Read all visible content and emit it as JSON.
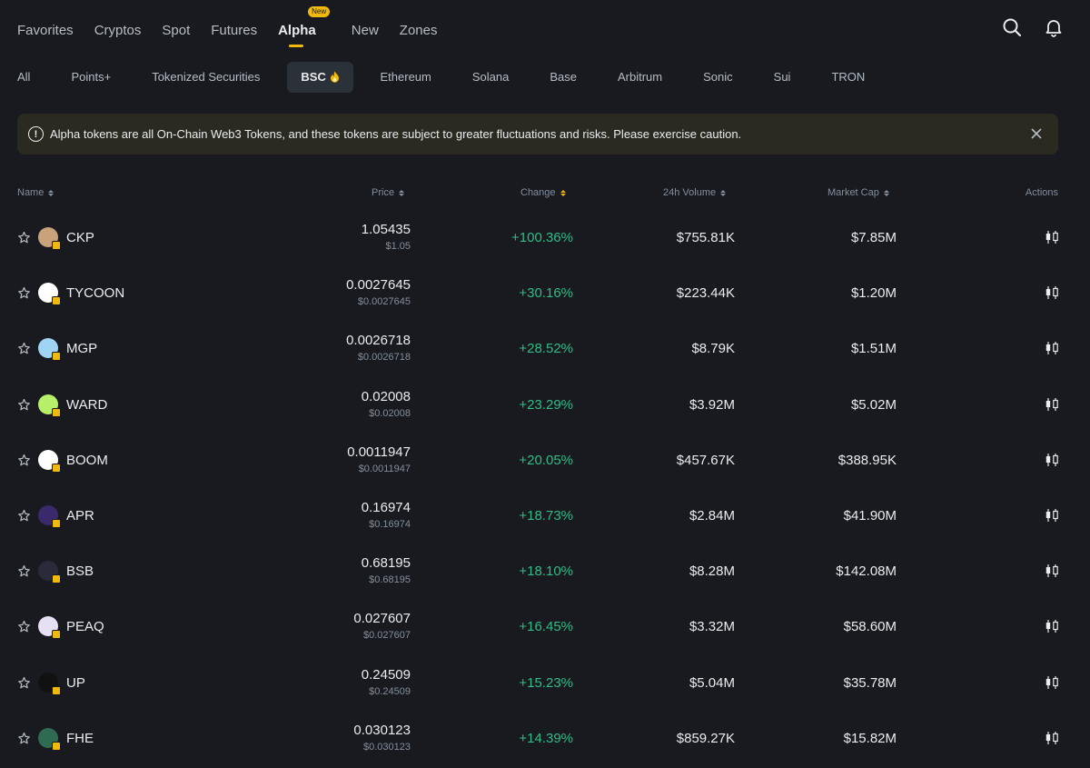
{
  "nav": {
    "tabs": [
      {
        "label": "Favorites"
      },
      {
        "label": "Cryptos"
      },
      {
        "label": "Spot"
      },
      {
        "label": "Futures"
      },
      {
        "label": "Alpha",
        "badge": "New",
        "active": true
      },
      {
        "label": "New"
      },
      {
        "label": "Zones"
      }
    ],
    "icons": [
      "search-icon",
      "bell-icon"
    ]
  },
  "chains": [
    {
      "label": "All"
    },
    {
      "label": "Points+"
    },
    {
      "label": "Tokenized Securities"
    },
    {
      "label": "BSC",
      "active": true,
      "icon": "fire-icon"
    },
    {
      "label": "Ethereum"
    },
    {
      "label": "Solana"
    },
    {
      "label": "Base"
    },
    {
      "label": "Arbitrum"
    },
    {
      "label": "Sonic"
    },
    {
      "label": "Sui"
    },
    {
      "label": "TRON"
    }
  ],
  "banner": {
    "message": "Alpha tokens are all On-Chain Web3 Tokens, and these tokens are subject to greater fluctuations and risks. Please exercise caution.",
    "icon": "alert-circle-icon"
  },
  "table": {
    "headers": {
      "name": "Name",
      "price": "Price",
      "change": "Change",
      "volume": "24h Volume",
      "mcap": "Market Cap",
      "actions": "Actions"
    },
    "rows": [
      {
        "symbol": "CKP",
        "price": "1.05435",
        "usd": "$1.05",
        "change": "+100.36%",
        "volume": "$755.81K",
        "mcap": "$7.85M",
        "color": "#c8a27a"
      },
      {
        "symbol": "TYCOON",
        "price": "0.0027645",
        "usd": "$0.0027645",
        "change": "+30.16%",
        "volume": "$223.44K",
        "mcap": "$1.20M",
        "color": "#ffffff"
      },
      {
        "symbol": "MGP",
        "price": "0.0026718",
        "usd": "$0.0026718",
        "change": "+28.52%",
        "volume": "$8.79K",
        "mcap": "$1.51M",
        "color": "#9fd4f5"
      },
      {
        "symbol": "WARD",
        "price": "0.02008",
        "usd": "$0.02008",
        "change": "+23.29%",
        "volume": "$3.92M",
        "mcap": "$5.02M",
        "color": "#b6f06a"
      },
      {
        "symbol": "BOOM",
        "price": "0.0011947",
        "usd": "$0.0011947",
        "change": "+20.05%",
        "volume": "$457.67K",
        "mcap": "$388.95K",
        "color": "#ffffff"
      },
      {
        "symbol": "APR",
        "price": "0.16974",
        "usd": "$0.16974",
        "change": "+18.73%",
        "volume": "$2.84M",
        "mcap": "$41.90M",
        "color": "#3a2a6b"
      },
      {
        "symbol": "BSB",
        "price": "0.68195",
        "usd": "$0.68195",
        "change": "+18.10%",
        "volume": "$8.28M",
        "mcap": "$142.08M",
        "color": "#2a2a3a"
      },
      {
        "symbol": "PEAQ",
        "price": "0.027607",
        "usd": "$0.027607",
        "change": "+16.45%",
        "volume": "$3.32M",
        "mcap": "$58.60M",
        "color": "#e6e0f5"
      },
      {
        "symbol": "UP",
        "price": "0.24509",
        "usd": "$0.24509",
        "change": "+15.23%",
        "volume": "$5.04M",
        "mcap": "$35.78M",
        "color": "#111111"
      },
      {
        "symbol": "FHE",
        "price": "0.030123",
        "usd": "$0.030123",
        "change": "+14.39%",
        "volume": "$859.27K",
        "mcap": "$15.82M",
        "color": "#2f6b52"
      }
    ]
  },
  "colors": {
    "background": "#181a20",
    "accent": "#f0b90b",
    "positive": "#2ebd85",
    "muted": "#848e9c"
  }
}
